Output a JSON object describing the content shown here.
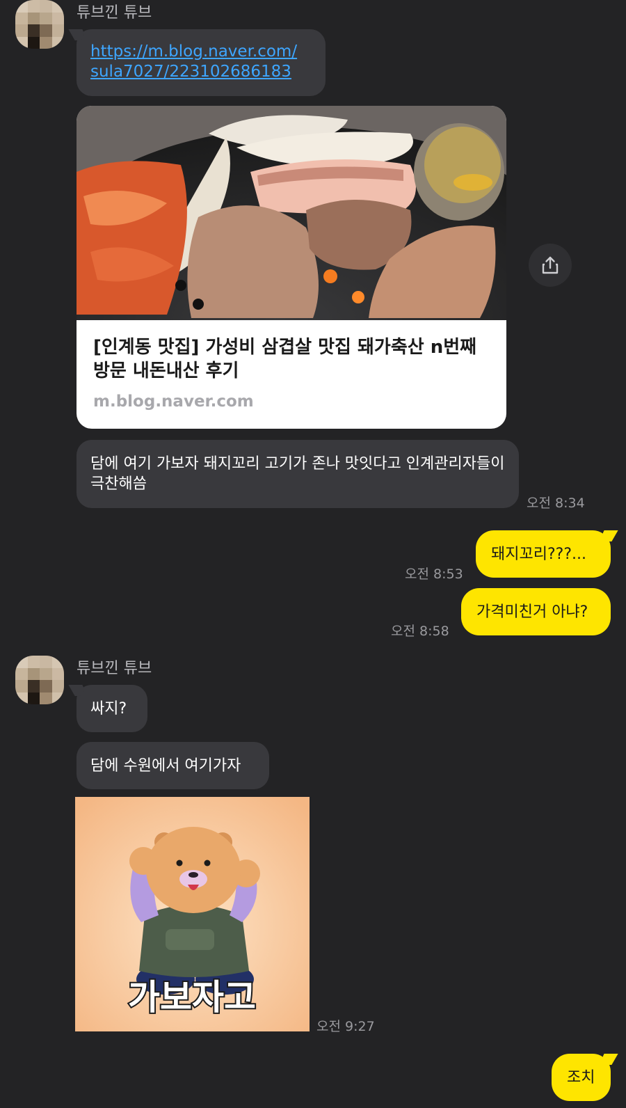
{
  "chat": {
    "sender_name": "튜브낀 튜브",
    "messages": {
      "link_line1": "https://m.blog.naver.com/",
      "link_line2": "sula7027/223102686183",
      "card_title": "[인계동 맛집] 가성비 삼겹살 맛집 돼가축산 n번째 방문 내돈내산 후기",
      "card_domain": "m.blog.naver.com",
      "msg_suggest": "담에 여기 가보자 돼지꼬리 고기가 존나 맛잇다고 인계관리자들이 극찬해씀",
      "time_1": "오전 8:34",
      "my_msg_1": "돼지꼬리???...",
      "time_2": "오전 8:53",
      "my_msg_2": "가격미친거 아냐?",
      "time_3": "오전 8:58",
      "msg_cheap": "싸지?",
      "msg_suwon": "담에 수원에서 여기가자",
      "sticker_text": "가보자고",
      "time_4": "오전 9:27",
      "my_msg_3": "조치"
    }
  },
  "icons": {
    "share": "share-icon",
    "avatar": "pixelated-avatar"
  },
  "colors": {
    "background": "#232325",
    "incoming_bubble": "#39393d",
    "outgoing_bubble": "#fee500",
    "link": "#3ea6ff"
  }
}
